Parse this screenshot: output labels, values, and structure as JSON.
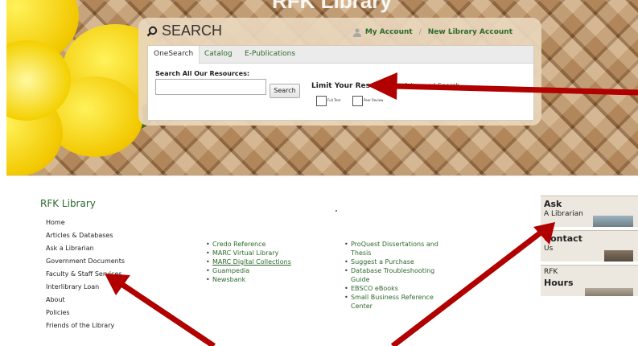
{
  "banner": {
    "title": "RFK Library"
  },
  "search": {
    "title": "SEARCH",
    "my_account": "My Account",
    "new_account": "New Library Account",
    "tabs": [
      "OneSearch",
      "Catalog",
      "E-Publications"
    ],
    "search_label": "Search All Our Resources:",
    "search_button": "Search",
    "limit_label": "Limit Your Results",
    "advanced": "Advanced Search",
    "checkbox_full": "Full Text",
    "checkbox_peer": "Peer Review"
  },
  "sidebar": {
    "heading": "RFK Library",
    "items": [
      "Home",
      "Articles & Databases",
      "Ask a Librarian",
      "Government Documents",
      "Faculty & Staff Services",
      "Interlibrary Loan",
      "About",
      "Policies",
      "Friends of the Library"
    ]
  },
  "col1": [
    "Credo Reference",
    "MARC Virtual Library",
    "MARC Digital Collections",
    "Guampedia",
    "Newsbank"
  ],
  "col2": {
    "i0a": "ProQuest Dissertations and",
    "i0b": "Thesis",
    "i1": "Suggest a Purchase",
    "i2a": "Database Troubleshooting",
    "i2b": "Guide",
    "i3": "EBSCO eBooks",
    "i4a": "Small Business Reference",
    "i4b": "Center"
  },
  "right": {
    "ask1": "Ask",
    "ask2": "A Librarian",
    "contact1": "Contact",
    "contact2": "Us",
    "hours1": "RFK",
    "hours2": "Hours"
  },
  "colors": {
    "link_green": "#2d6a2d",
    "arrow_red": "#b00000",
    "flower_yellow": "#f2c800"
  }
}
